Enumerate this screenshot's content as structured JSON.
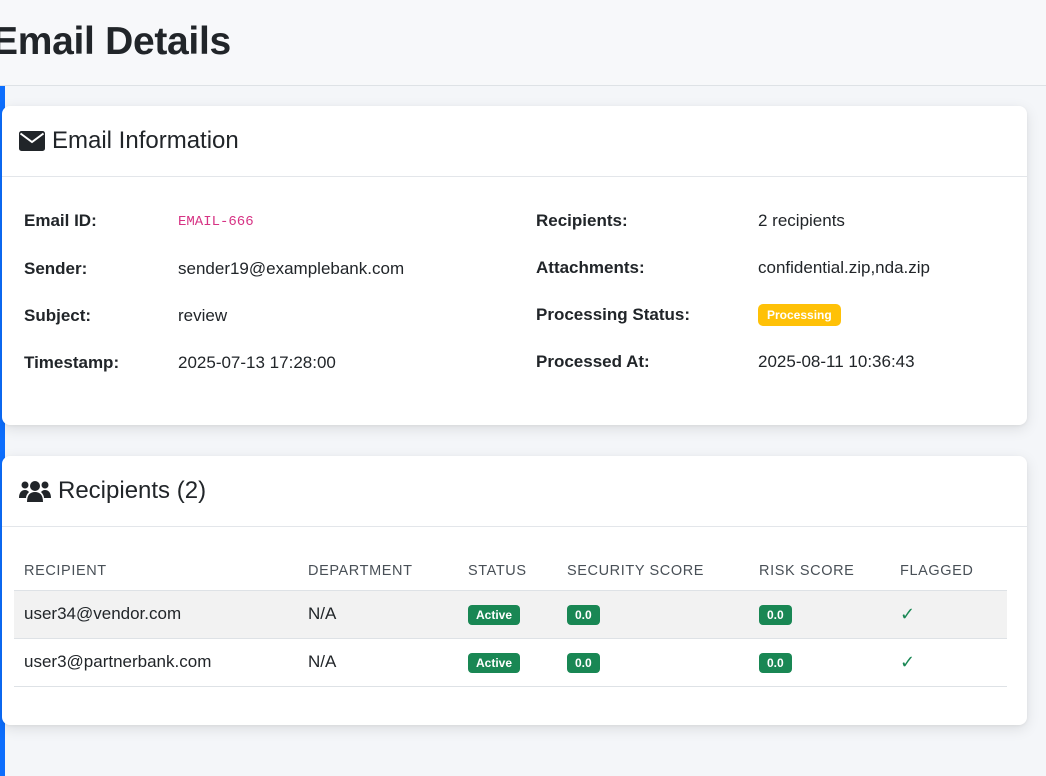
{
  "page": {
    "title": "Email Details"
  },
  "email_info": {
    "header": "Email Information",
    "icon": "envelope-icon",
    "fields_left": [
      {
        "label": "Email ID:",
        "value": "EMAIL-666"
      },
      {
        "label": "Sender:",
        "value": "sender19@examplebank.com"
      },
      {
        "label": "Subject:",
        "value": "review"
      },
      {
        "label": "Timestamp:",
        "value": "2025-07-13 17:28:00"
      }
    ],
    "fields_right": [
      {
        "label": "Recipients:",
        "value": "2 recipients"
      },
      {
        "label": "Attachments:",
        "value": "confidential.zip,nda.zip"
      },
      {
        "label": "Processing Status:",
        "value": "Processing"
      },
      {
        "label": "Processed At:",
        "value": "2025-08-11 10:36:43"
      }
    ]
  },
  "recipients": {
    "header": "Recipients (2)",
    "icon": "users-icon",
    "columns": [
      "RECIPIENT",
      "DEPARTMENT",
      "STATUS",
      "SECURITY SCORE",
      "RISK SCORE",
      "FLAGGED"
    ],
    "rows": [
      {
        "recipient": "user34@vendor.com",
        "department": "N/A",
        "status": "Active",
        "security_score": "0.0",
        "risk_score": "0.0",
        "flagged": "✓"
      },
      {
        "recipient": "user3@partnerbank.com",
        "department": "N/A",
        "status": "Active",
        "security_score": "0.0",
        "risk_score": "0.0",
        "flagged": "✓"
      }
    ]
  },
  "colors": {
    "accent": "#0d6efd",
    "status_processing": "#ffc107",
    "status_success": "#198754",
    "code_pink": "#d63384"
  }
}
